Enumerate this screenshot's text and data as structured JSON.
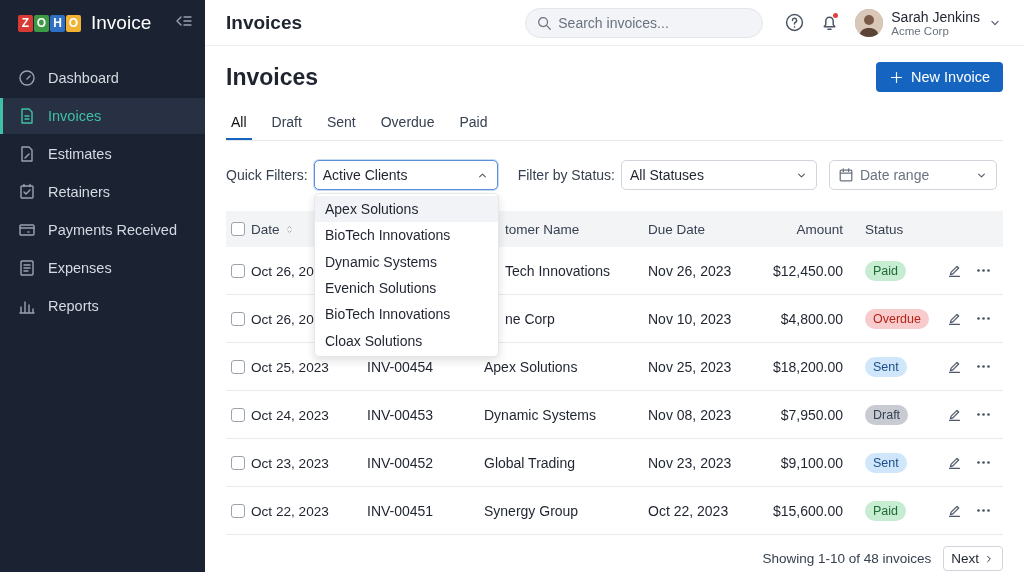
{
  "app": {
    "logo_letters": [
      {
        "letter": "Z",
        "color": "#d83a34"
      },
      {
        "letter": "O",
        "color": "#3c9a45"
      },
      {
        "letter": "H",
        "color": "#2f6fc4"
      },
      {
        "letter": "O",
        "color": "#f2b233"
      }
    ],
    "name": "Invoice"
  },
  "sidebar": {
    "items": [
      {
        "label": "Dashboard",
        "selected": false
      },
      {
        "label": "Invoices",
        "selected": true
      },
      {
        "label": "Estimates",
        "selected": false
      },
      {
        "label": "Retainers",
        "selected": false
      },
      {
        "label": "Payments Received",
        "selected": false
      },
      {
        "label": "Expenses",
        "selected": false
      },
      {
        "label": "Reports",
        "selected": false
      }
    ]
  },
  "topbar": {
    "title": "Invoices",
    "search": {
      "placeholder": "Search invoices..."
    },
    "notifications": {
      "unread": true
    },
    "user": {
      "name": "Sarah Jenkins",
      "org": "Acme Corp"
    }
  },
  "page": {
    "title": "Invoices",
    "new_button": "New Invoice"
  },
  "tabs": [
    {
      "label": "All",
      "selected": true
    },
    {
      "label": "Draft",
      "selected": false
    },
    {
      "label": "Sent",
      "selected": false
    },
    {
      "label": "Overdue",
      "selected": false
    },
    {
      "label": "Paid",
      "selected": false
    }
  ],
  "filters": {
    "quick_label": "Quick Filters:",
    "quick": {
      "value": "Active Clients",
      "expanded": true,
      "options": [
        {
          "label": "Apex Solutions",
          "selected": true
        },
        {
          "label": "BioTech Innovations",
          "selected": false
        },
        {
          "label": "Dynamic Systems",
          "selected": false
        },
        {
          "label": "Evenich Solutions",
          "selected": false
        },
        {
          "label": "BioTech Innovations",
          "selected": false
        },
        {
          "label": "Cloax Solutions",
          "selected": false
        }
      ]
    },
    "status_label": "Filter by Status:",
    "status": {
      "value": "All Statuses"
    },
    "date": {
      "placeholder": "Date range"
    }
  },
  "table": {
    "select_all": {
      "checked": false
    },
    "columns": [
      {
        "label": "Date",
        "sortable": true
      },
      {},
      {
        "label": "tomer Name",
        "covered": true
      },
      {
        "label": "Due Date"
      },
      {
        "label": "Amount"
      },
      {
        "label": "Status"
      }
    ],
    "rows": [
      {
        "checked": false,
        "date": "Oct 26, 20",
        "customer": "Tech Innovations",
        "customer_covered": true,
        "due": "Nov 26, 2023",
        "amount": "$12,450.00",
        "status": {
          "label": "Paid",
          "kind": "paid"
        }
      },
      {
        "checked": false,
        "date": "Oct 26, 20",
        "customer": "ne Corp",
        "customer_covered": true,
        "due": "Nov 10, 2023",
        "amount": "$4,800.00",
        "status": {
          "label": "Overdue",
          "kind": "overdue"
        }
      },
      {
        "checked": false,
        "date": "Oct 25, 2023",
        "number": "INV-00454",
        "customer": "Apex Solutions",
        "due": "Nov 25, 2023",
        "amount": "$18,200.00",
        "status": {
          "label": "Sent",
          "kind": "sent"
        }
      },
      {
        "checked": false,
        "date": "Oct 24, 2023",
        "number": "INV-00453",
        "customer": "Dynamic Systems",
        "due": "Nov 08, 2023",
        "amount": "$7,950.00",
        "status": {
          "label": "Draft",
          "kind": "draft"
        }
      },
      {
        "checked": false,
        "date": "Oct 23, 2023",
        "number": "INV-00452",
        "customer": "Global Trading",
        "due": "Nov 23, 2023",
        "amount": "$9,100.00",
        "status": {
          "label": "Sent",
          "kind": "sent"
        }
      },
      {
        "checked": false,
        "date": "Oct 22, 2023",
        "number": "INV-00451",
        "customer": "Synergy Group",
        "due": "Oct 22, 2023",
        "amount": "$15,600.00",
        "status": {
          "label": "Paid",
          "kind": "paid"
        }
      }
    ]
  },
  "pagination": {
    "summary": "Showing 1-10 of 48 invoices",
    "next": "Next"
  }
}
